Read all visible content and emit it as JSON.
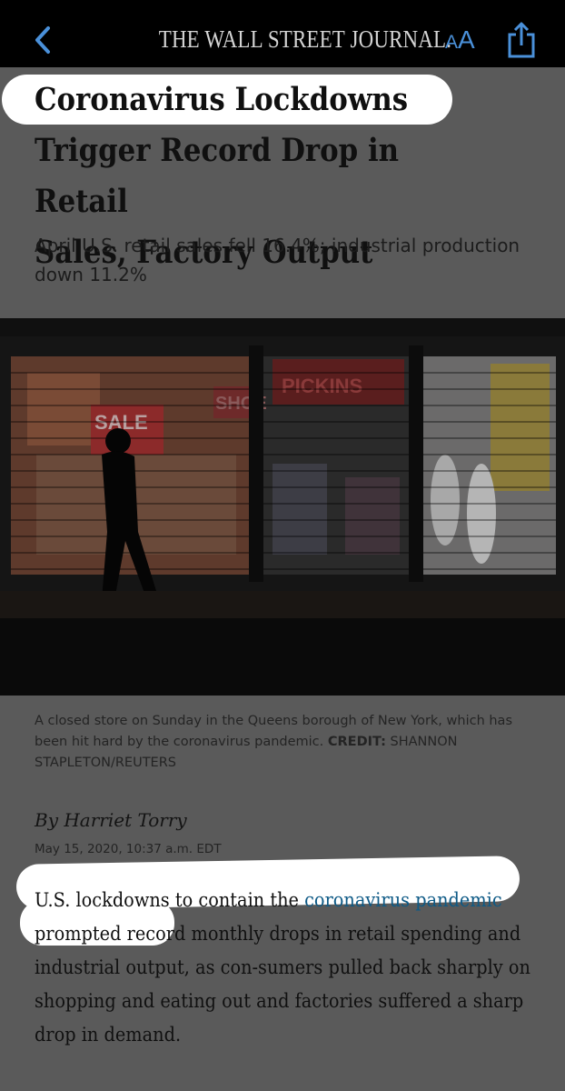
{
  "topbar": {
    "masthead": "THE WALL STREET JOURNAL.",
    "text_size_small": "A",
    "text_size_large": "A"
  },
  "article": {
    "headline": "Coronavirus Lockdowns\nTrigger Record Drop in Retail\nSales, Factory Output",
    "deck": "April U.S. retail sales fell 16.4%; industrial production\ndown 11.2%",
    "photo": {
      "sign_sale": "SALE",
      "sign_store": "SHOE",
      "sign_pickins": "PICKINS"
    },
    "caption": {
      "text": "A closed store on Sunday in the Queens borough of New York, which has been hit hard by the coronavirus pandemic.",
      "credit_label": "CREDIT:",
      "credit_value": "SHANNON STAPLETON/REUTERS"
    },
    "byline": "By Harriet Torry",
    "dateline": "May 15, 2020, 10:37 a.m. EDT",
    "body": {
      "before_link": "U.S. lockdowns to contain the ",
      "link": "coronavirus pandemic",
      "after_link": " prompted record monthly drops in retail spending and industrial output, as con-sumers pulled back sharply on shopping and eating out and factories suffered a sharp drop in demand."
    }
  },
  "colors": {
    "overlay": "#5a5a5a",
    "highlight": "#ffffff",
    "link": "#0e5a86",
    "ui_accent": "#4a90d9"
  }
}
